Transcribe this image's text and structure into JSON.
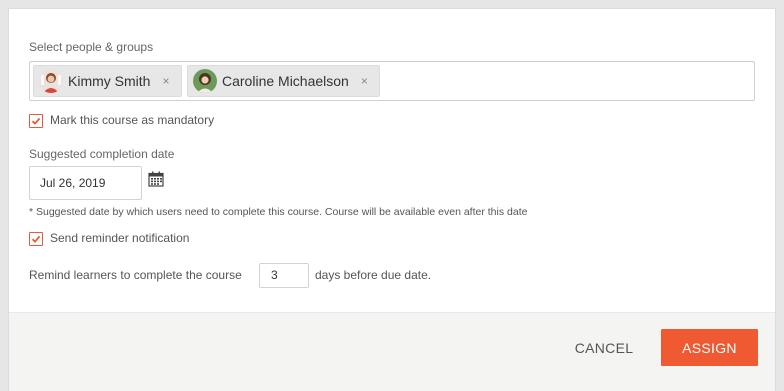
{
  "form": {
    "people_label": "Select people & groups",
    "people": [
      {
        "name": "Kimmy Smith"
      },
      {
        "name": "Caroline Michaelson"
      }
    ],
    "remove_glyph": "×",
    "mandatory": {
      "label": "Mark this course as mandatory",
      "checked": true
    },
    "completion": {
      "label": "Suggested completion date",
      "date_value": "Jul 26, 2019",
      "note": "* Suggested date by which users need to complete this course. Course will be available even after this date"
    },
    "reminder": {
      "label": "Send reminder notification",
      "checked": true
    },
    "remind": {
      "prefix": "Remind learners to complete the course",
      "days_value": "3",
      "suffix": "days before due date."
    }
  },
  "footer": {
    "cancel_label": "CANCEL",
    "assign_label": "ASSIGN"
  },
  "colors": {
    "accent": "#ef5a32",
    "checkbox_border": "#e85a37",
    "footer_bg": "#f4f4f3"
  },
  "icons": {
    "calendar": "calendar-icon",
    "remove": "close-icon",
    "check": "checkmark-icon"
  }
}
